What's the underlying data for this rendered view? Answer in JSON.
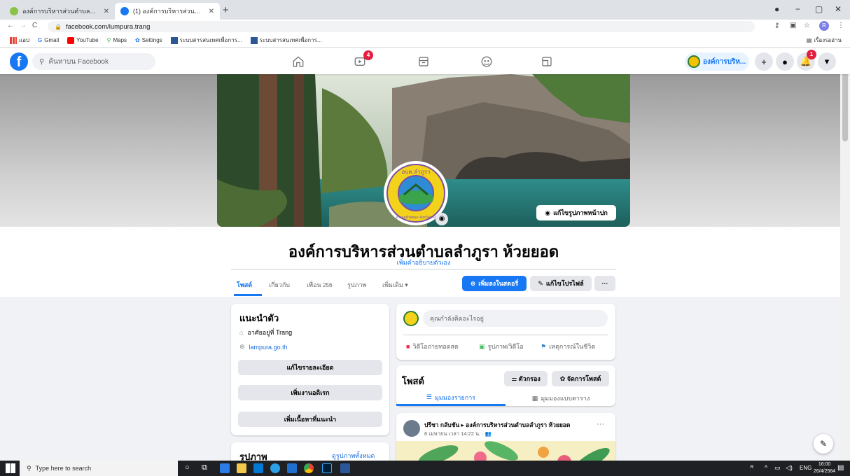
{
  "browser": {
    "tabs": [
      {
        "title": "องค์การบริหารส่วนตำบลลำภูรา 199 ..."
      },
      {
        "title": "(1) องค์การบริหารส่วนตำบลลำภูรา ห้..."
      }
    ],
    "url": "facebook.com/lumpura.trang",
    "bookmarks": [
      "แอป",
      "Gmail",
      "YouTube",
      "Maps",
      "Settings",
      "ระบบสารสนเทศเพื่อการ...",
      "ระบบสารสนเทศเพื่อการ..."
    ],
    "reading_list": "เรื่องรออ่าน"
  },
  "facebook": {
    "search_placeholder": "ค้นหาบน Facebook",
    "notifications_badge": "4",
    "bell_badge": "1",
    "profile_chip": "องค์การบริห...",
    "accent": "#1877f2"
  },
  "page": {
    "title": "องค์การบริหารส่วนตำบลลำภูรา ห้วยยอด",
    "add_bio": "เพิ่มคำอธิบายตัวเอง",
    "edit_cover": "แก้ไขรูปภาพหน้าปก",
    "logo_text_top": "อบต.ลำภูรา",
    "logo_text_bottom": "อำเภอห้วยยอด จังหวัดตรัง",
    "tabs": [
      "โพสต์",
      "เกี่ยวกับ",
      "เพื่อน",
      "รูปภาพ",
      "เพิ่มเติม ▾"
    ],
    "friends_count": "256",
    "add_story": "เพิ่มลงในสตอรี่",
    "edit_profile": "แก้ไขโปรไฟล์",
    "more_dots": "···"
  },
  "intro": {
    "heading": "แนะนำตัว",
    "lives_in": "อาศัยอยู่ที่ Trang",
    "website": "lampura.go.th",
    "buttons": [
      "แก้ไขรายละเอียด",
      "เพิ่มงานอดิเรก",
      "เพิ่มเนื้อหาที่แนะนำ"
    ]
  },
  "photos": {
    "heading": "รูปภาพ",
    "see_all": "ดูรูปภาพทั้งหมด"
  },
  "composer": {
    "placeholder": "คุณกำลังคิดอะไรอยู่",
    "live": "วิดีโอถ่ายทอดสด",
    "photo": "รูปภาพ/วิดีโอ",
    "life_event": "เหตุการณ์ในชีวิต"
  },
  "posts": {
    "heading": "โพสต์",
    "filter": "ตัวกรอง",
    "manage": "จัดการโพสต์",
    "list_view": "มุมมองรายการ",
    "grid_view": "มุมมองแบบตาราง",
    "post_author": "ปรีชา กลับชัน ▸ องค์การบริหารส่วนตำบลลำภูรา ห้วยยอด",
    "post_time": "8 เมษายน เวลา 14:22 น. · "
  },
  "taskbar": {
    "search": "Type here to search",
    "lang": "ENG",
    "time": "16:00",
    "date": "26/4/2564"
  }
}
